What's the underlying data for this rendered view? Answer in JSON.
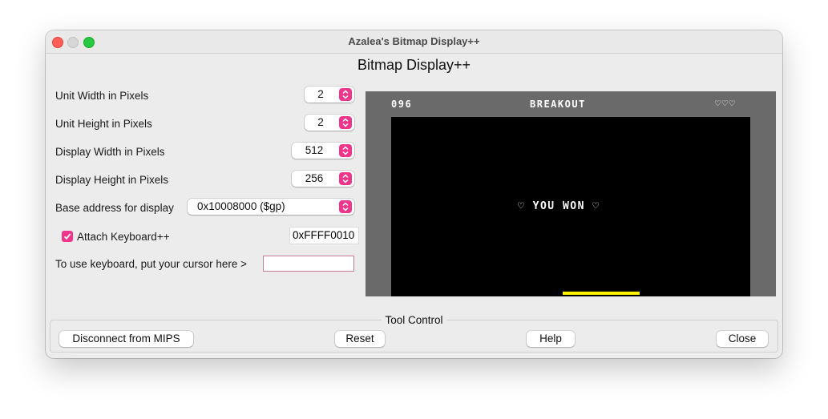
{
  "window": {
    "title": "Azalea's Bitmap Display++"
  },
  "heading": "Bitmap Display++",
  "settings": {
    "unit_width": {
      "label": "Unit Width in Pixels",
      "value": "2"
    },
    "unit_height": {
      "label": "Unit Height in Pixels",
      "value": "2"
    },
    "display_width": {
      "label": "Display Width in Pixels",
      "value": "512"
    },
    "display_height": {
      "label": "Display Height in Pixels",
      "value": "256"
    },
    "base_address": {
      "label": "Base address for display",
      "value": "0x10008000 ($gp)"
    }
  },
  "keyboard": {
    "attach_label": "Attach Keyboard++",
    "attach_checked": true,
    "address": "0xFFFF0010",
    "cursor_label": "To use keyboard, put your cursor here >",
    "cursor_value": ""
  },
  "game": {
    "score": "096",
    "title": "BREAKOUT",
    "lives": "♡♡♡",
    "message": "♡ YOU WON ♡",
    "paddle_color": "#fff200"
  },
  "tool_control": {
    "title": "Tool Control",
    "disconnect_label": "Disconnect from MIPS",
    "reset_label": "Reset",
    "help_label": "Help",
    "close_label": "Close"
  },
  "colors": {
    "accent": "#f0358a",
    "close_light": "#ff5f57",
    "maximize_light": "#28c840",
    "display_border": "#6a6a6a"
  }
}
